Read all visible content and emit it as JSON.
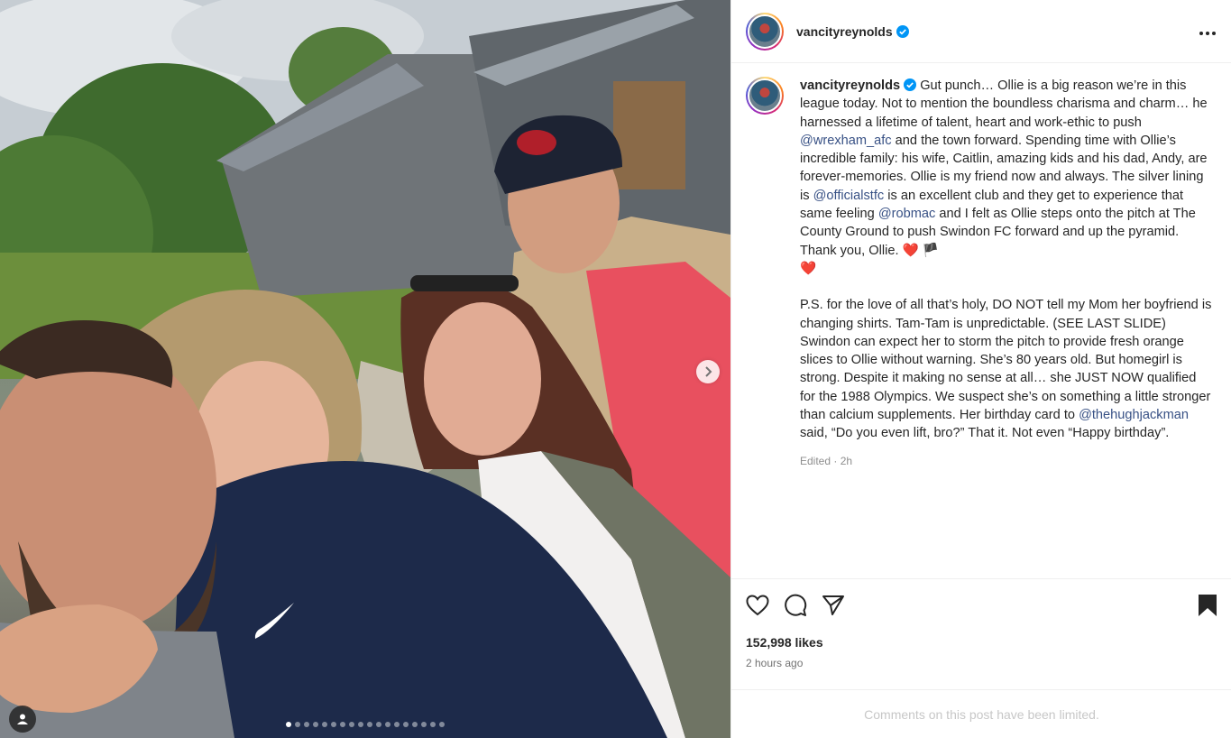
{
  "post": {
    "username": "vancityreynolds",
    "verified": true,
    "more_icon": "more-horizontal-icon"
  },
  "media": {
    "slide_count": 18,
    "active_slide": 1
  },
  "caption": {
    "username": "vancityreynolds",
    "p1_a": "Gut punch… Ollie is a big reason we’re in this league today. Not to mention the boundless charisma and charm… he harnessed a lifetime of talent, heart and work-ethic to push ",
    "mention_1": "@wrexham_afc",
    "p1_b": " and the town forward. Spending time with Ollie’s incredible family: his wife, Caitlin, amazing kids and his dad, Andy, are forever-memories. Ollie is my friend now and always. The silver lining is ",
    "mention_2": "@officialstfc",
    "p1_c": " is an excellent club and they get to experience that same feeling ",
    "mention_3": "@robmac",
    "p1_d": " and I felt as Ollie steps onto the pitch at The County Ground to push Swindon FC forward and up the pyramid. Thank you, Ollie. ",
    "emoji_1": "❤️",
    "emoji_2": "🏴",
    "emoji_3": "❤️",
    "p2_a": "P.S. for the love of all that’s holy, DO NOT tell my Mom her boyfriend is changing shirts. Tam-Tam is unpredictable. (SEE LAST SLIDE) Swindon can expect her to storm the pitch to provide fresh orange slices to Ollie without warning. She’s 80 years old. But homegirl is strong. Despite it making no sense at all… she JUST NOW qualified for the 1988 Olympics. We suspect she’s on something a little stronger than calcium supplements. Her birthday card to ",
    "mention_4": "@thehughjackman",
    "p2_b": " said, “Do you even lift, bro?” That it. Not even “Happy birthday”.",
    "edited": "Edited · 2h"
  },
  "actions": {
    "likes": "152,998 likes",
    "time_ago": "2 hours ago"
  },
  "comments": {
    "limited_text": "Comments on this post have been limited."
  },
  "colors": {
    "mention": "#385185",
    "verified": "#0095f6",
    "heart_emoji": "#e8334a",
    "secondary_text": "#737373"
  }
}
